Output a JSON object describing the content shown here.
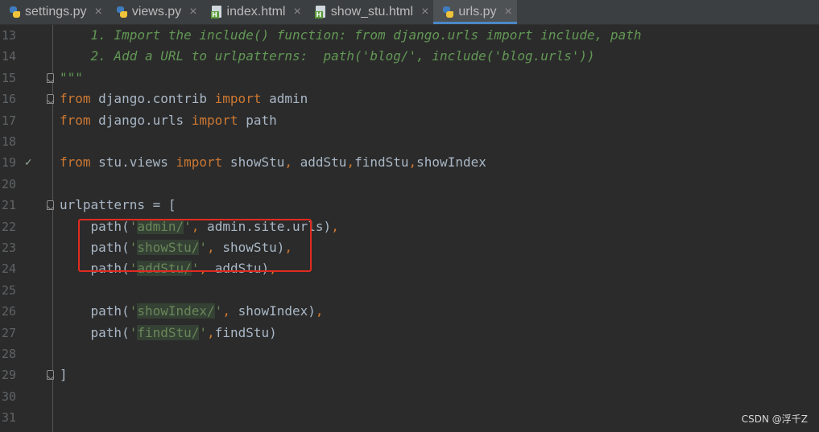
{
  "tabs": [
    {
      "label": "settings.py",
      "icon": "python-file-icon",
      "active": false
    },
    {
      "label": "views.py",
      "icon": "python-file-icon",
      "active": false
    },
    {
      "label": "index.html",
      "icon": "html-file-icon",
      "active": false
    },
    {
      "label": "show_stu.html",
      "icon": "html-file-icon",
      "active": false
    },
    {
      "label": "urls.py",
      "icon": "python-file-icon",
      "active": true
    }
  ],
  "close_glyph": "×",
  "lines": [
    {
      "num": "13",
      "code": "    1. Import the include() function: from django.urls import include, path"
    },
    {
      "num": "14",
      "code": "    2. Add a URL to urlpatterns:  path('blog/', include('blog.urls'))"
    },
    {
      "num": "15",
      "code": "\"\"\""
    },
    {
      "num": "16",
      "code": "from django.contrib import admin"
    },
    {
      "num": "17",
      "code": "from django.urls import path"
    },
    {
      "num": "18",
      "code": ""
    },
    {
      "num": "19",
      "code": "from stu.views import showStu, addStu,findStu,showIndex"
    },
    {
      "num": "20",
      "code": ""
    },
    {
      "num": "21",
      "code": "urlpatterns = ["
    },
    {
      "num": "22",
      "code": "    path('admin/', admin.site.urls),"
    },
    {
      "num": "23",
      "code": "    path('showStu/', showStu),"
    },
    {
      "num": "24",
      "code": "    path('addStu/', addStu),"
    },
    {
      "num": "25",
      "code": ""
    },
    {
      "num": "26",
      "code": "    path('showIndex/', showIndex),"
    },
    {
      "num": "27",
      "code": "    path('findStu/',findStu)"
    },
    {
      "num": "28",
      "code": ""
    },
    {
      "num": "29",
      "code": "]"
    },
    {
      "num": "30",
      "code": ""
    },
    {
      "num": "31",
      "code": ""
    }
  ],
  "gutter_check_line": "19",
  "watermark": "CSDN @浮千Z",
  "colors": {
    "keyword": "#cc7832",
    "string": "#6a8759",
    "comment": "#629755",
    "text": "#a9b7c6",
    "highlight": "#e02b20",
    "accent": "#4a88c7"
  }
}
